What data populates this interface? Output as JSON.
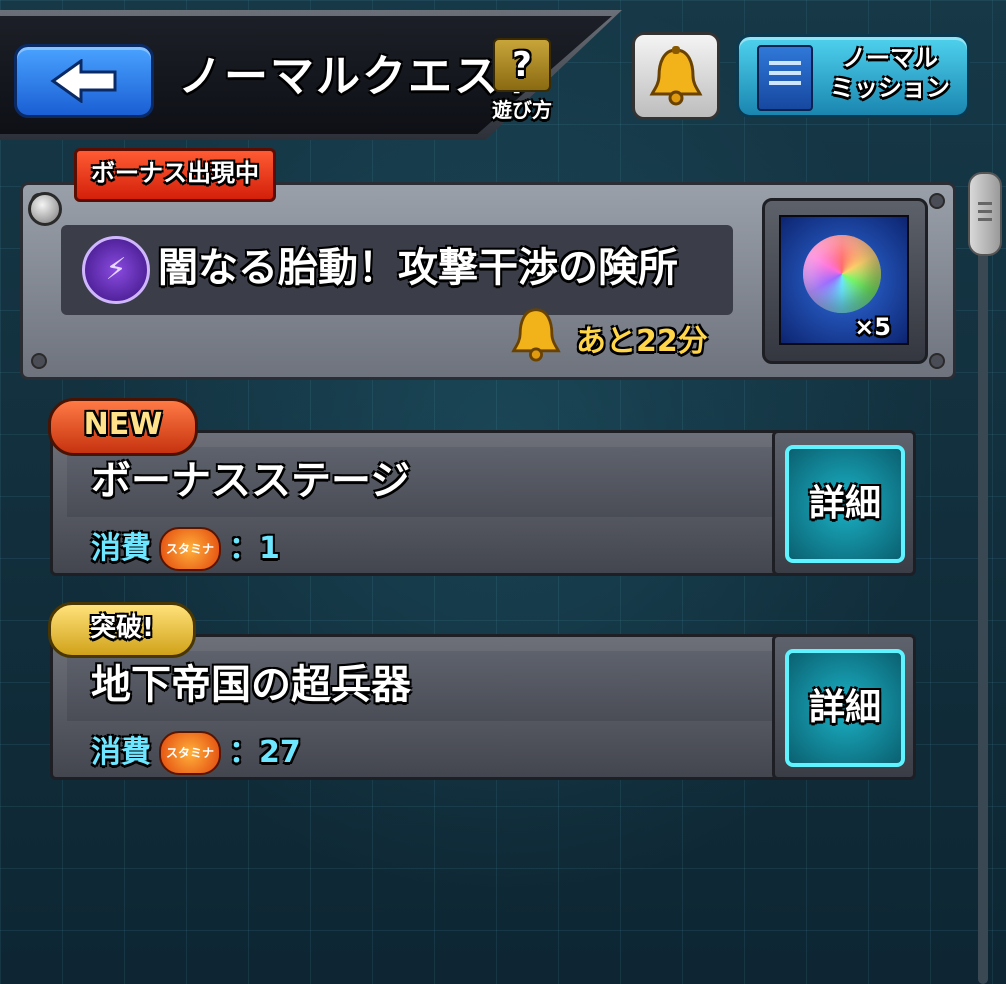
{
  "header": {
    "title": "ノーマルクエスト",
    "help_label": "遊び方",
    "help_glyph": "?",
    "mission_label_line1": "ノーマル",
    "mission_label_line2": "ミッション"
  },
  "bonus": {
    "badge": "ボーナス出現中",
    "title": "闇なる胎動！攻撃干渉の険所",
    "remaining": "あと22分",
    "reward_count": "×5",
    "element": "dark"
  },
  "stages": [
    {
      "tag": "NEW",
      "name": "ボーナスステージ",
      "cost_label": "消費",
      "stamina_label": "スタミナ",
      "cost_value": "：1",
      "detail_label": "詳細"
    },
    {
      "tag": "突破!",
      "name": "地下帝国の超兵器",
      "cost_label": "消費",
      "stamina_label": "スタミナ",
      "cost_value": "：27",
      "detail_label": "詳細"
    }
  ],
  "colors": {
    "accent_cyan": "#6ee6ff",
    "timer_yellow": "#ffd54a",
    "bonus_badge": "#d3200a"
  }
}
